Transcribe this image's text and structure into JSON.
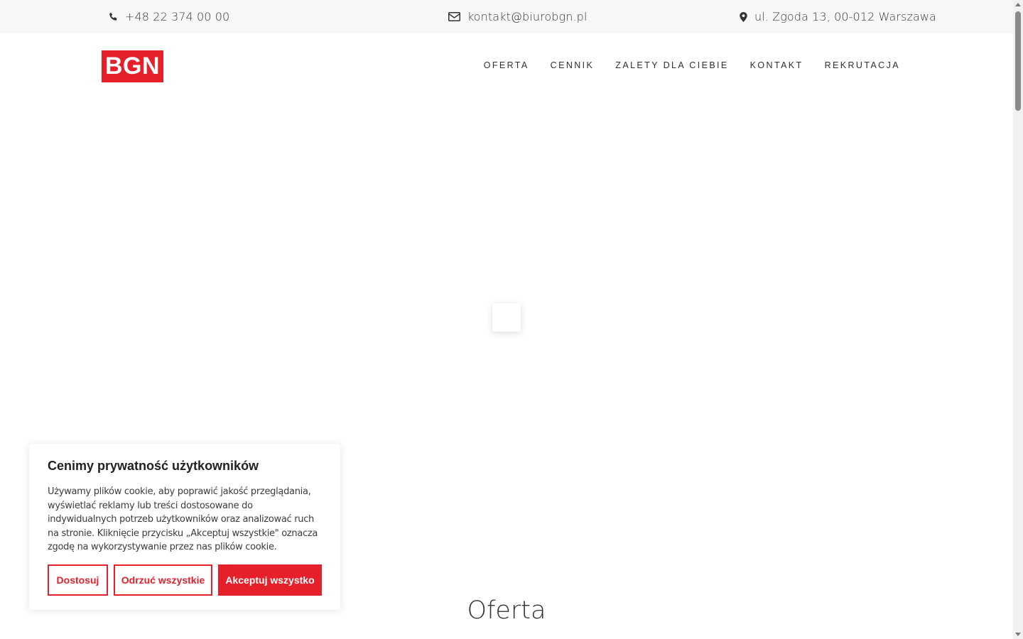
{
  "topbar": {
    "phone": "+48 22 374 00 00",
    "email": "kontakt@biurobgn.pl",
    "address": "ul. Zgoda 13, 00-012 Warszawa",
    "phone_icon": "phone-icon",
    "email_icon": "envelope-icon",
    "address_icon": "map-pin-icon"
  },
  "header": {
    "logo_text": "BGN",
    "brand_color": "#e5202b",
    "nav": [
      {
        "label": "OFERTA"
      },
      {
        "label": "CENNIK"
      },
      {
        "label": "ZALETY DLA CIEBIE"
      },
      {
        "label": "KONTAKT"
      },
      {
        "label": "REKRUTACJA"
      }
    ]
  },
  "main": {
    "section_title": "Oferta"
  },
  "cookie_banner": {
    "title": "Cenimy prywatność użytkowników",
    "text": "Używamy plików cookie, aby poprawić jakość przeglądania, wyświetlać reklamy lub treści dostosowane do indywidualnych potrzeb użytkowników oraz analizować ruch na stronie. Kliknięcie przycisku „Akceptuj wszystkie\" oznacza zgodę na wykorzystywanie przez nas plików cookie.",
    "customize_label": "Dostosuj",
    "reject_label": "Odrzuć wszystkie",
    "accept_label": "Akceptuj wszystko"
  }
}
